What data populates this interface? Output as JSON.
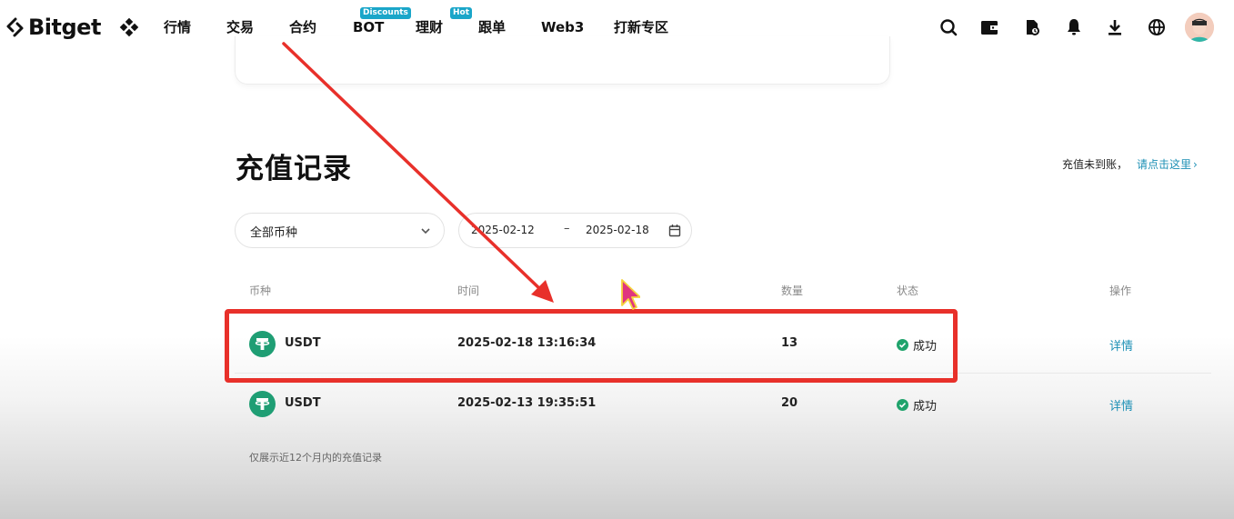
{
  "nav": {
    "brand": "Bitget",
    "items": [
      {
        "label": "行情"
      },
      {
        "label": "交易"
      },
      {
        "label": "合约"
      },
      {
        "label": "BOT",
        "badge": "Discounts"
      },
      {
        "label": "理财",
        "badge": "Hot"
      },
      {
        "label": "跟单"
      },
      {
        "label": "Web3"
      },
      {
        "label": "打新专区"
      }
    ],
    "right_icons": [
      "search-icon",
      "wallet-icon",
      "orders-icon",
      "bell-icon",
      "download-icon",
      "globe-icon"
    ]
  },
  "page": {
    "title": "充值记录",
    "notice_text": "充值未到账，",
    "notice_link": "请点击这里",
    "notice_chevron": "›"
  },
  "filters": {
    "coin_select": "全部币种",
    "date_start": "2025-02-12",
    "date_separator": "–",
    "date_end": "2025-02-18"
  },
  "table": {
    "headers": {
      "coin": "币种",
      "time": "时间",
      "amount": "数量",
      "status": "状态",
      "action": "操作"
    },
    "rows": [
      {
        "coin": "USDT",
        "time": "2025-02-18 13:16:34",
        "amount": "13",
        "status": "成功",
        "action": "详情"
      },
      {
        "coin": "USDT",
        "time": "2025-02-13 19:35:51",
        "amount": "20",
        "status": "成功",
        "action": "详情"
      }
    ]
  },
  "footnote": "仅展示近12个月内的充值记录",
  "colors": {
    "accent_link": "#1d90b5",
    "badge": "#1aa6c9",
    "usdt_green": "#1f9e74",
    "success_green": "#20a36c",
    "annotation_red": "#e8302a",
    "cursor_pink": "#e0357f"
  }
}
